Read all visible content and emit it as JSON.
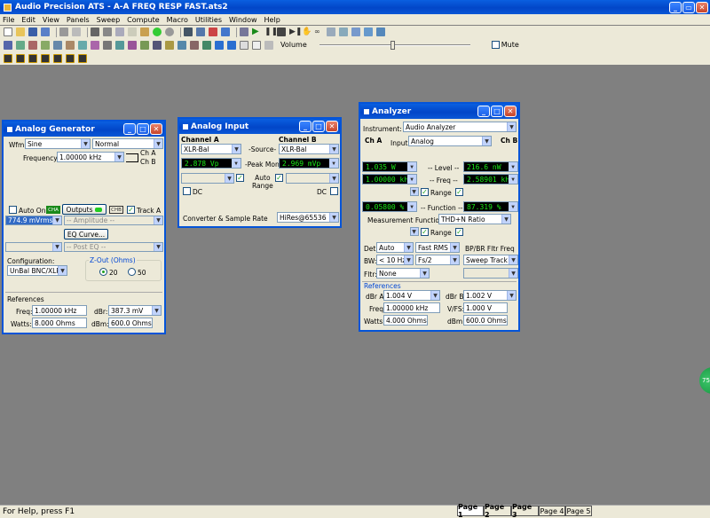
{
  "app": {
    "title": "Audio Precision ATS - A-A FREQ RESP FAST.ats2"
  },
  "menu": [
    "File",
    "Edit",
    "View",
    "Panels",
    "Sweep",
    "Compute",
    "Macro",
    "Utilities",
    "Window",
    "Help"
  ],
  "toolbar": {
    "volume_label": "Volume",
    "mute_label": "Mute"
  },
  "status": {
    "text": "For Help, press F1"
  },
  "pages": [
    "Page 1",
    "Page 2",
    "Page 3",
    "Page 4",
    "Page 5"
  ],
  "gen": {
    "title": "Analog Generator",
    "wfm_label": "Wfm:",
    "wfm": "Sine",
    "wfm_mode": "Normal",
    "freq_label": "Frequency:",
    "freq": "1.00000 kHz",
    "cha": "Ch A",
    "chb": "Ch B",
    "auto_on": "Auto On",
    "outputs": "Outputs",
    "ch_a_badge": "CHA",
    "ch_b_badge": "CHB",
    "track_a": "Track A",
    "amplitude_value": "774.9  mVrms",
    "amplitude_label": "-- Amplitude --",
    "eq_curve": "EQ Curve...",
    "post_eq": "-- Post EQ --",
    "config_label": "Configuration:",
    "config": "UnBal BNC/XLR",
    "zout_label": "Z-Out (Ohms)",
    "z20": "20",
    "z50": "50",
    "refs_label": "References",
    "ref_freq_label": "Freq:",
    "ref_freq": "1.00000 kHz",
    "ref_watts_label": "Watts:",
    "ref_watts": "8.000   Ohms",
    "dbr_label": "dBr:",
    "dbr": "387.3   mV",
    "dbm_label": "dBm:",
    "dbm": "600.0   Ohms"
  },
  "inp": {
    "title": "Analog Input",
    "cha_label": "Channel A",
    "chb_label": "Channel B",
    "source_label": "-Source-",
    "cha_source": "XLR-Bal",
    "chb_source": "XLR-Bal",
    "peak_label": "-Peak Mon-",
    "cha_peak": "2.878    Vp",
    "chb_peak": "2.969   mVp",
    "auto_range": "Auto\nRange",
    "dc_a": "DC",
    "dc_b": "DC",
    "converter_label": "Converter & Sample Rate",
    "converter": "HiRes@65536"
  },
  "an": {
    "title": "Analyzer",
    "instrument_label": "Instrument:",
    "instrument": "Audio Analyzer",
    "cha": "Ch A",
    "chb": "Ch B",
    "input_label": "Input:",
    "input": "Analog",
    "level_label": "-- Level --",
    "level_a": "1.035    W",
    "level_b": "216.6    nW",
    "freq_label": "-- Freq --",
    "freq_a": "1.00000 kHz",
    "freq_b": "2.58901 kHz",
    "range": "Range",
    "func_label": "-- Function --",
    "func_a": "0.05800  %",
    "func_b": "87.319   %",
    "meas_label": "Measurement Function :",
    "meas": "THD+N Ratio",
    "det_label": "Det:",
    "det": "Auto",
    "det_mode": "Fast RMS",
    "bp_label": "BP/BR Fltr Freq",
    "bw_label": "BW:",
    "bw": "< 10 Hz",
    "bw_hi": "Fs/2",
    "sweep_track": "Sweep Track",
    "fltr_label": "Fltr:",
    "fltr": "None",
    "refs_label": "References",
    "dbra_label": "dBr A:",
    "dbra": "1.004   V",
    "dbrb_label": "dBr B:",
    "dbrb": "1.002   V",
    "ref_freq_label": "Freq:",
    "ref_freq": "1.00000 kHz",
    "vfs_label": "V/FS:",
    "vfs": "1.000   V",
    "watts_label": "Watts:",
    "watts": "4.000    Ohms",
    "dbm_label": "dBm:",
    "dbm": "600.0   Ohms"
  },
  "badge": {
    "text": "75"
  },
  "colors": {
    "titlebar": "#0454d8",
    "desktop": "#808080",
    "meter_bg": "#000000",
    "meter_fg": "#18e818"
  }
}
